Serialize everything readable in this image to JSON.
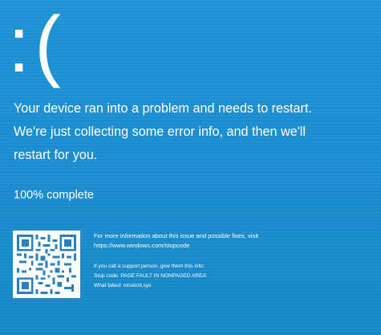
{
  "bsod": {
    "sad_face": ":(",
    "message_line1": "Your device ran into a problem and needs to restart.",
    "message_line2": "We're just collecting some error info, and then we'll",
    "message_line3": "restart for you.",
    "progress_text": "100% complete",
    "info_line1": "For more information about this issue and possible fixes, visit",
    "info_line2": "https://www.windows.com/stopcode",
    "support_line": "If you call a support person, give them this info:",
    "stop_code_line": "Stop code: PAGE FAULT IN NONPAGED AREA",
    "what_failed_line": "What failed: ntoskrnl.sys"
  },
  "colors": {
    "background": "#1b8fd2",
    "text": "#ffffff"
  },
  "icons": {
    "qr": "qr-code-icon"
  }
}
